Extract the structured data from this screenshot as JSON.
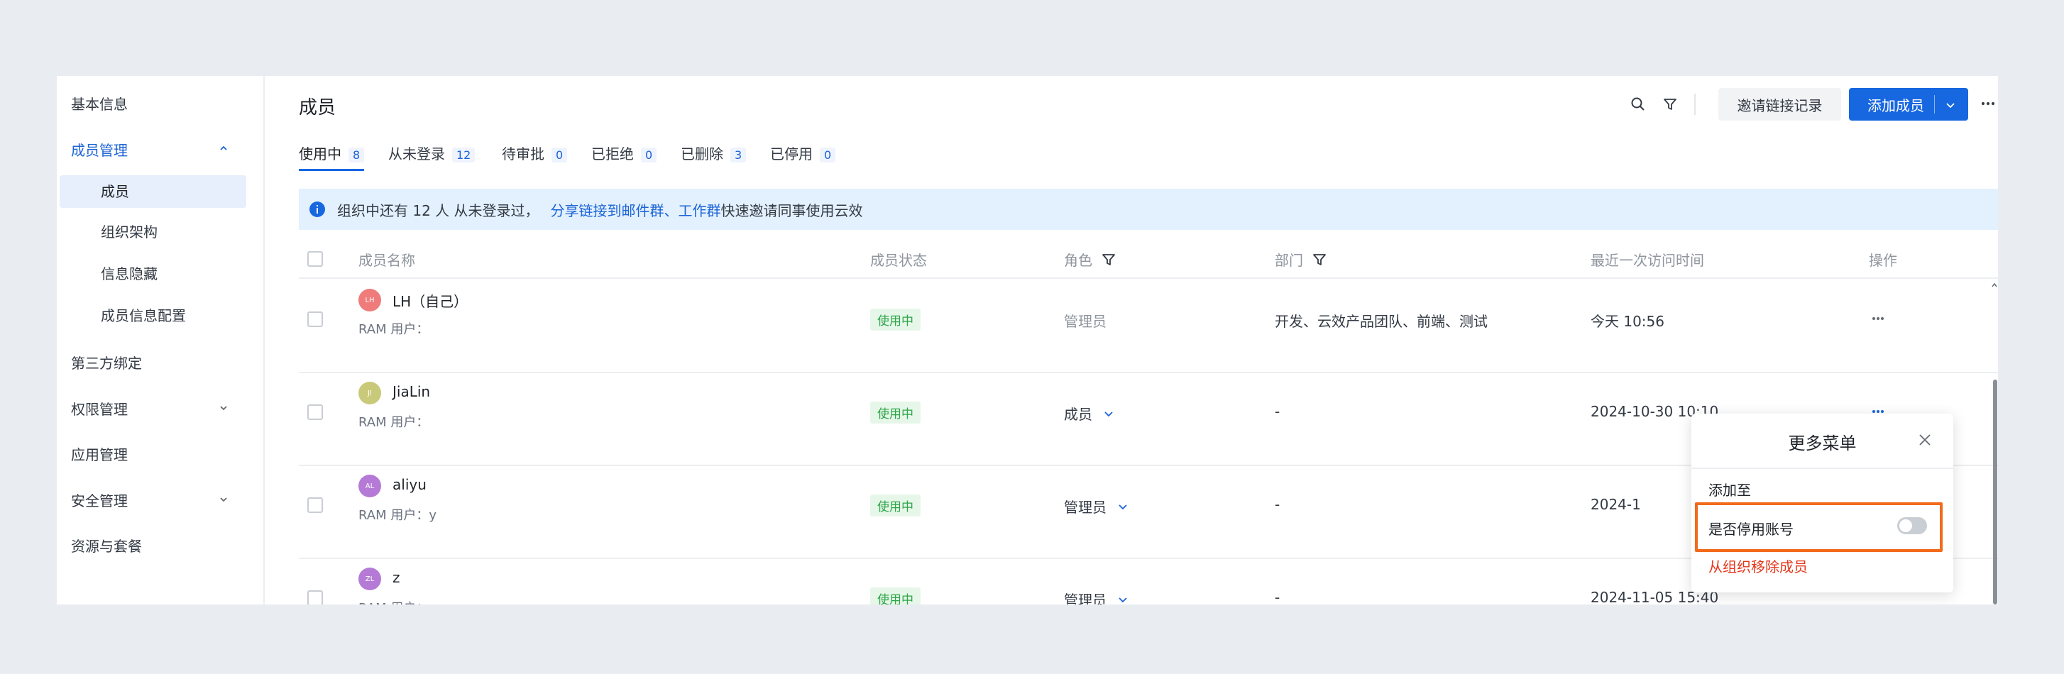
{
  "sidebar": {
    "basic_info": "基本信息",
    "member_mgmt": "成员管理",
    "sub_members": "成员",
    "sub_org": "组织架构",
    "sub_info_hide": "信息隐藏",
    "sub_info_config": "成员信息配置",
    "third_party": "第三方绑定",
    "permission": "权限管理",
    "app_mgmt": "应用管理",
    "security": "安全管理",
    "resources": "资源与套餐"
  },
  "header": {
    "title": "成员",
    "invite_records": "邀请链接记录",
    "add_member": "添加成员"
  },
  "tabs": [
    {
      "label": "使用中",
      "count": "8"
    },
    {
      "label": "从未登录",
      "count": "12"
    },
    {
      "label": "待审批",
      "count": "0"
    },
    {
      "label": "已拒绝",
      "count": "0"
    },
    {
      "label": "已删除",
      "count": "3"
    },
    {
      "label": "已停用",
      "count": "0"
    }
  ],
  "banner": {
    "text": "组织中还有 12 人 从未登录过，",
    "link": "分享链接到邮件群、工作群",
    "suffix": "快速邀请同事使用云效"
  },
  "table": {
    "headers": {
      "name": "成员名称",
      "status": "成员状态",
      "role": "角色",
      "dept": "部门",
      "last_visit": "最近一次访问时间",
      "actions": "操作"
    },
    "rows": [
      {
        "initials": "LH",
        "name": "LH（自己）",
        "sub": "RAM 用户：",
        "status": "使用中",
        "role": "管理员",
        "dept": "开发、云效产品团队、前端、测试",
        "last_visit": "今天 10:56",
        "avatar_color": "#ef7b7b"
      },
      {
        "initials": "JI",
        "name": "JiaLin",
        "sub": "RAM 用户：",
        "status": "使用中",
        "role": "成员",
        "dept": "-",
        "last_visit": "2024-10-30 10:10",
        "avatar_color": "#c9c97a"
      },
      {
        "initials": "AL",
        "name": "aliyu",
        "sub": "RAM 用户：y",
        "status": "使用中",
        "role": "管理员",
        "dept": "-",
        "last_visit": "2024-1",
        "avatar_color": "#b57ad6"
      },
      {
        "initials": "ZL",
        "name": "z",
        "sub": "RAM 用户：z",
        "status": "使用中",
        "role": "管理员",
        "dept": "-",
        "last_visit": "2024-11-05 15:40",
        "avatar_color": "#b57ad6"
      }
    ]
  },
  "popup": {
    "title": "更多菜单",
    "add_to": "添加至",
    "disable_account": "是否停用账号",
    "remove": "从组织移除成员"
  }
}
